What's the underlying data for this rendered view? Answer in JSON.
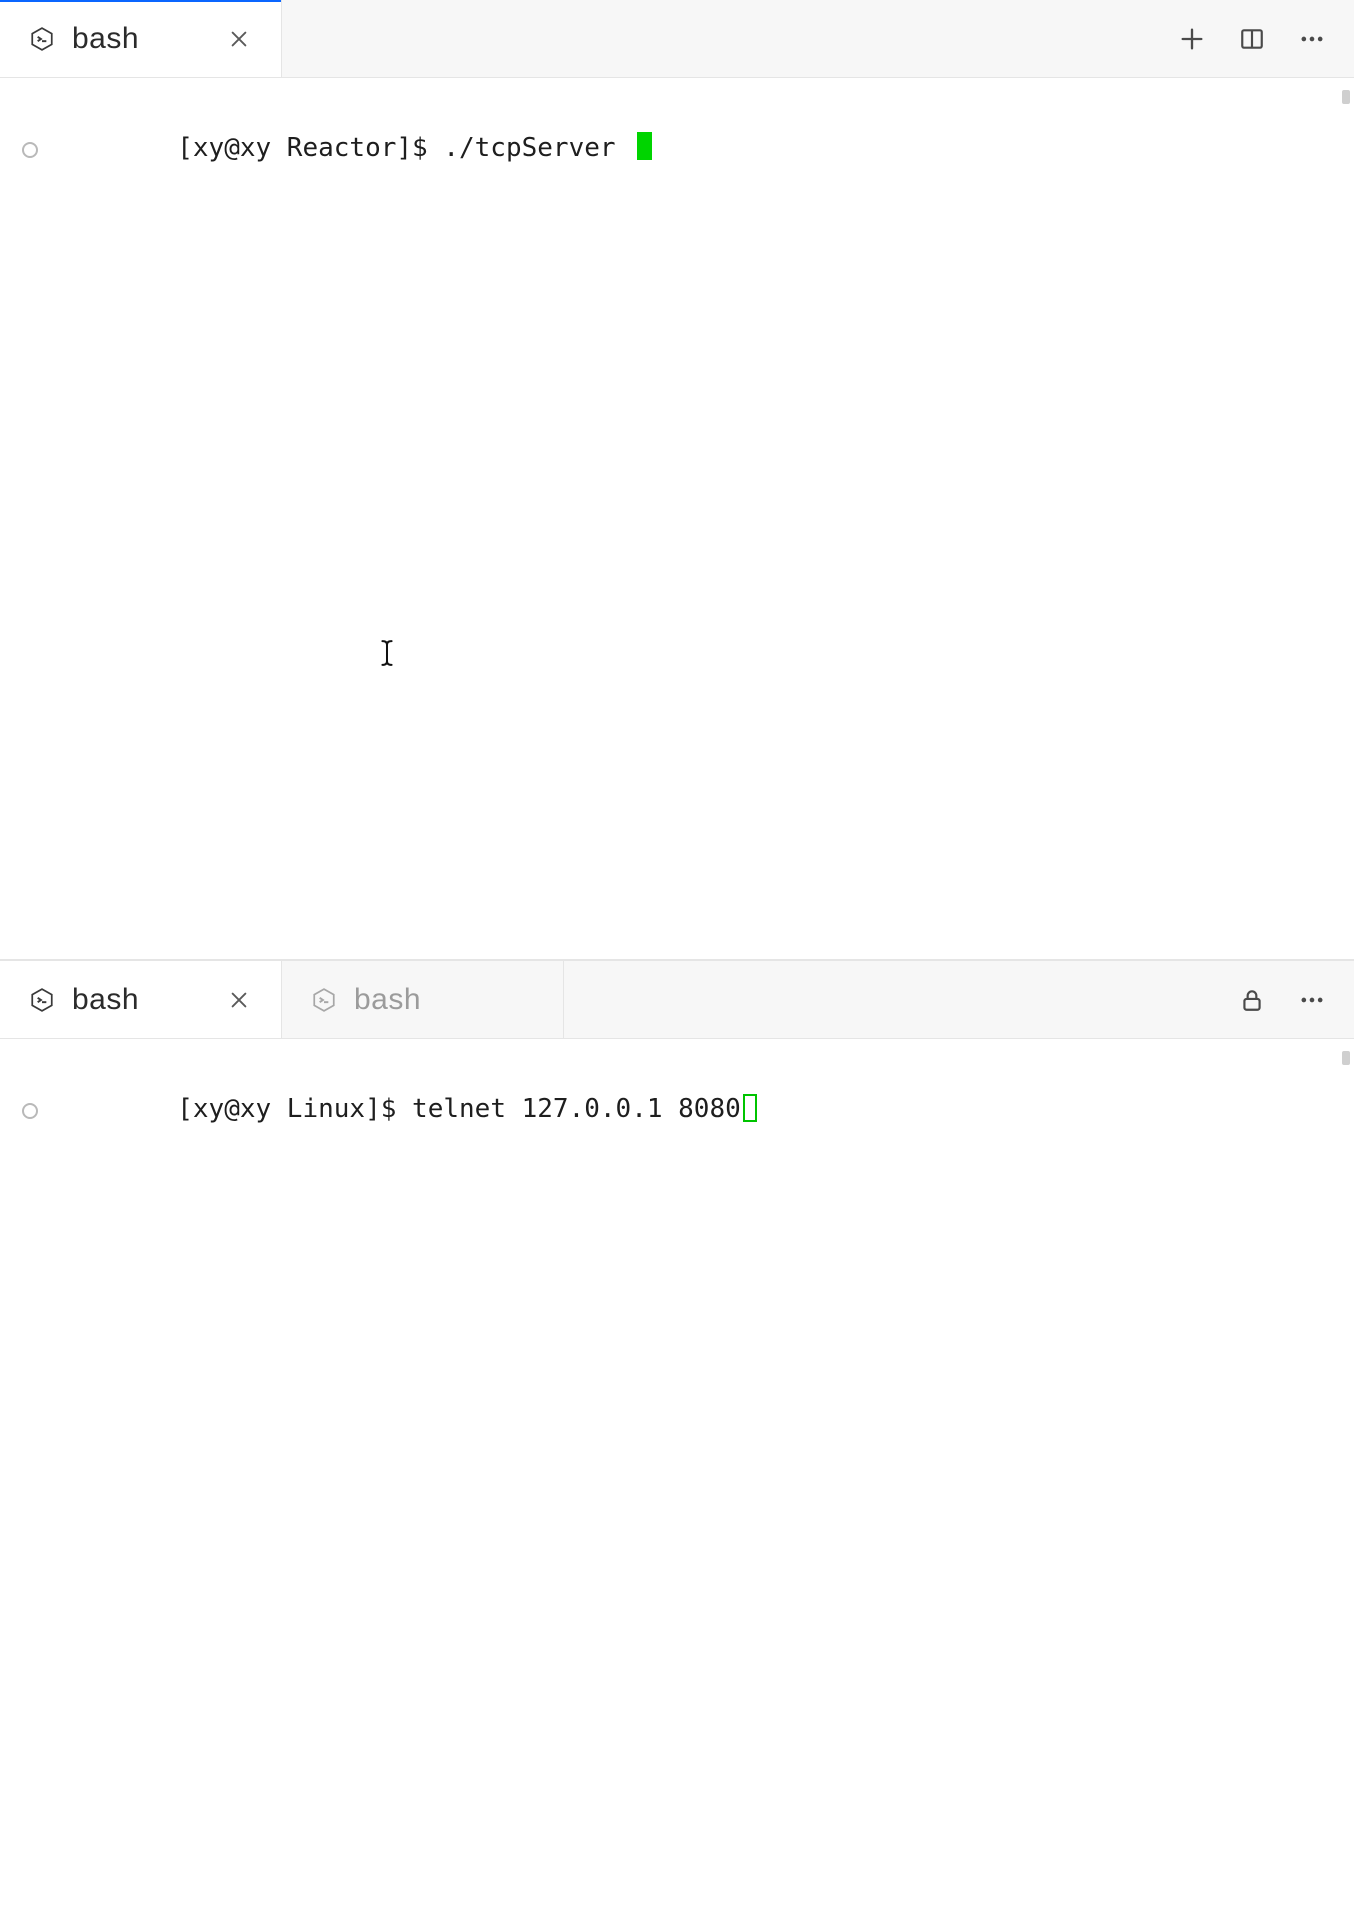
{
  "top": {
    "tabs": [
      {
        "label": "bash"
      }
    ],
    "prompt": "[xy@xy Reactor]$ ",
    "command": "./tcpServer "
  },
  "bottom": {
    "tabs": [
      {
        "label": "bash"
      },
      {
        "label": "bash"
      }
    ],
    "prompt": "[xy@xy Linux]$ ",
    "command": "telnet 127.0.0.1 8080"
  }
}
